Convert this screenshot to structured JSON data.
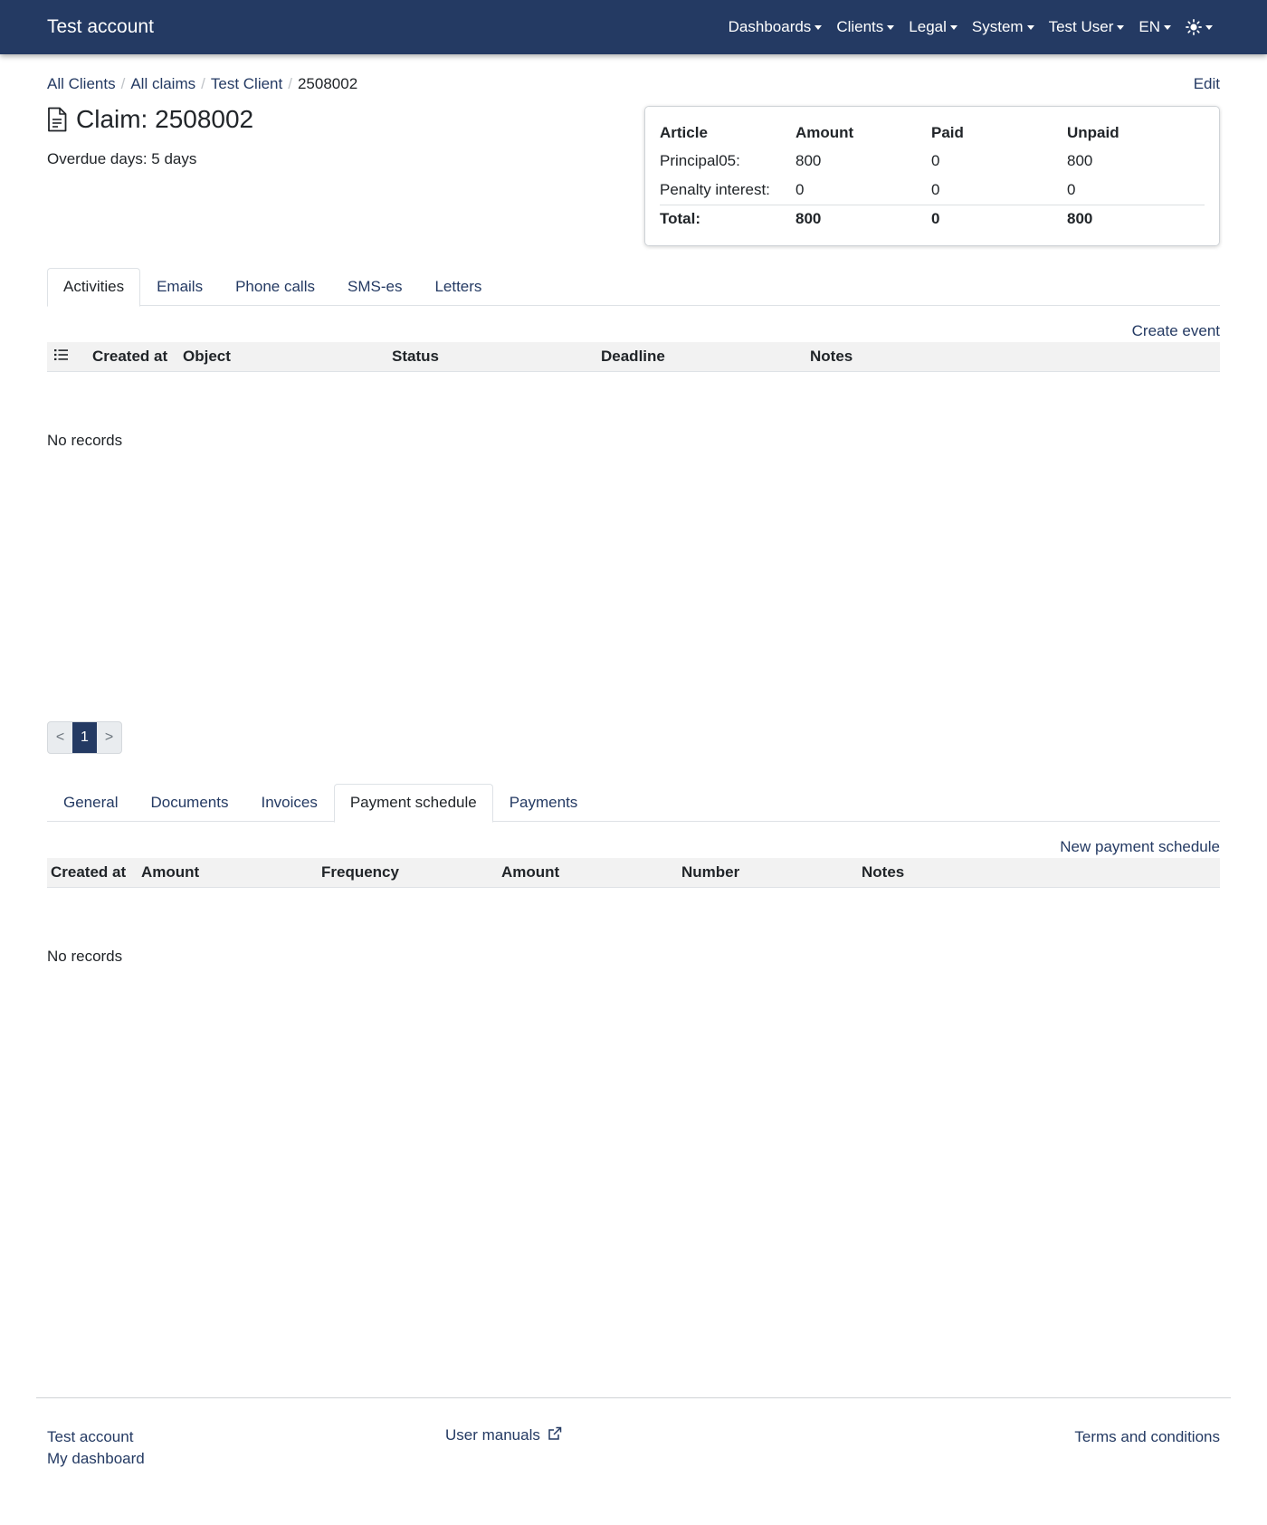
{
  "navbar": {
    "brand": "Test account",
    "items": [
      "Dashboards",
      "Clients",
      "Legal",
      "System",
      "Test User",
      "EN"
    ],
    "theme_icon": "sun-icon"
  },
  "breadcrumb": [
    "All Clients",
    "All claims",
    "Test Client",
    "2508002"
  ],
  "edit_label": "Edit",
  "title": "Claim: 2508002",
  "overdue": "Overdue days: 5 days",
  "summary": {
    "headers": [
      "Article",
      "Amount",
      "Paid",
      "Unpaid"
    ],
    "rows": [
      [
        "Principal05:",
        "800",
        "0",
        "800"
      ],
      [
        "Penalty interest:",
        "0",
        "0",
        "0"
      ]
    ],
    "total": [
      "Total:",
      "800",
      "0",
      "800"
    ]
  },
  "activity_tabs": [
    "Activities",
    "Emails",
    "Phone calls",
    "SMS-es",
    "Letters"
  ],
  "create_event_label": "Create event",
  "activity_columns": [
    "Created at",
    "Object",
    "Status",
    "Deadline",
    "Notes"
  ],
  "no_records": "No records",
  "pagination": {
    "prev": "<",
    "current": "1",
    "next": ">"
  },
  "detail_tabs": [
    "General",
    "Documents",
    "Invoices",
    "Payment schedule",
    "Payments"
  ],
  "new_schedule_label": "New payment schedule",
  "schedule_columns": [
    "Created at",
    "Amount",
    "Frequency",
    "Amount",
    "Number",
    "Notes"
  ],
  "footer": {
    "account": "Test account",
    "dashboard": "My dashboard",
    "manuals": "User manuals",
    "terms": "Terms and conditions"
  }
}
